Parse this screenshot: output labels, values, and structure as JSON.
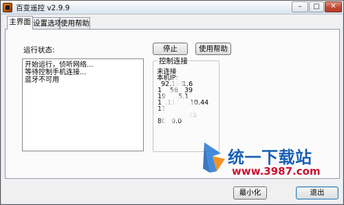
{
  "window": {
    "title": "百变遥控 v2.9.9",
    "controls": {
      "minimize": "–",
      "maximize": "□",
      "close": "✕"
    }
  },
  "tabs": [
    {
      "label": "主界面",
      "active": true
    },
    {
      "label": "设置选项",
      "active": false
    },
    {
      "label": "使用帮助",
      "active": false
    }
  ],
  "main": {
    "status_label": "运行状态:",
    "log_lines": [
      "开始运行，侦听网络...",
      "等待控制手机连接...",
      "蓝牙不可用"
    ],
    "stop_button": "停止",
    "help_button": "使用帮助",
    "connection_group": {
      "title": "控制连接",
      "status": "未连接",
      "local_ip_label": "本机IP:",
      "ip_fragments": [
        "92.168",
        "1.6",
        "1",
        "58",
        "39",
        "19",
        "5.1",
        "1",
        ".117",
        "10.44",
        "11",
        "45",
        "80",
        "0.0"
      ]
    }
  },
  "footer": {
    "minimize_button": "最小化",
    "exit_button": "退出"
  },
  "watermark": {
    "site_name": "统一下载站",
    "url": "www.3987.com"
  },
  "colors": {
    "watermark_blue": "#1a5fb4",
    "watermark_red": "#c8102e",
    "close_button": "#c04a35"
  }
}
